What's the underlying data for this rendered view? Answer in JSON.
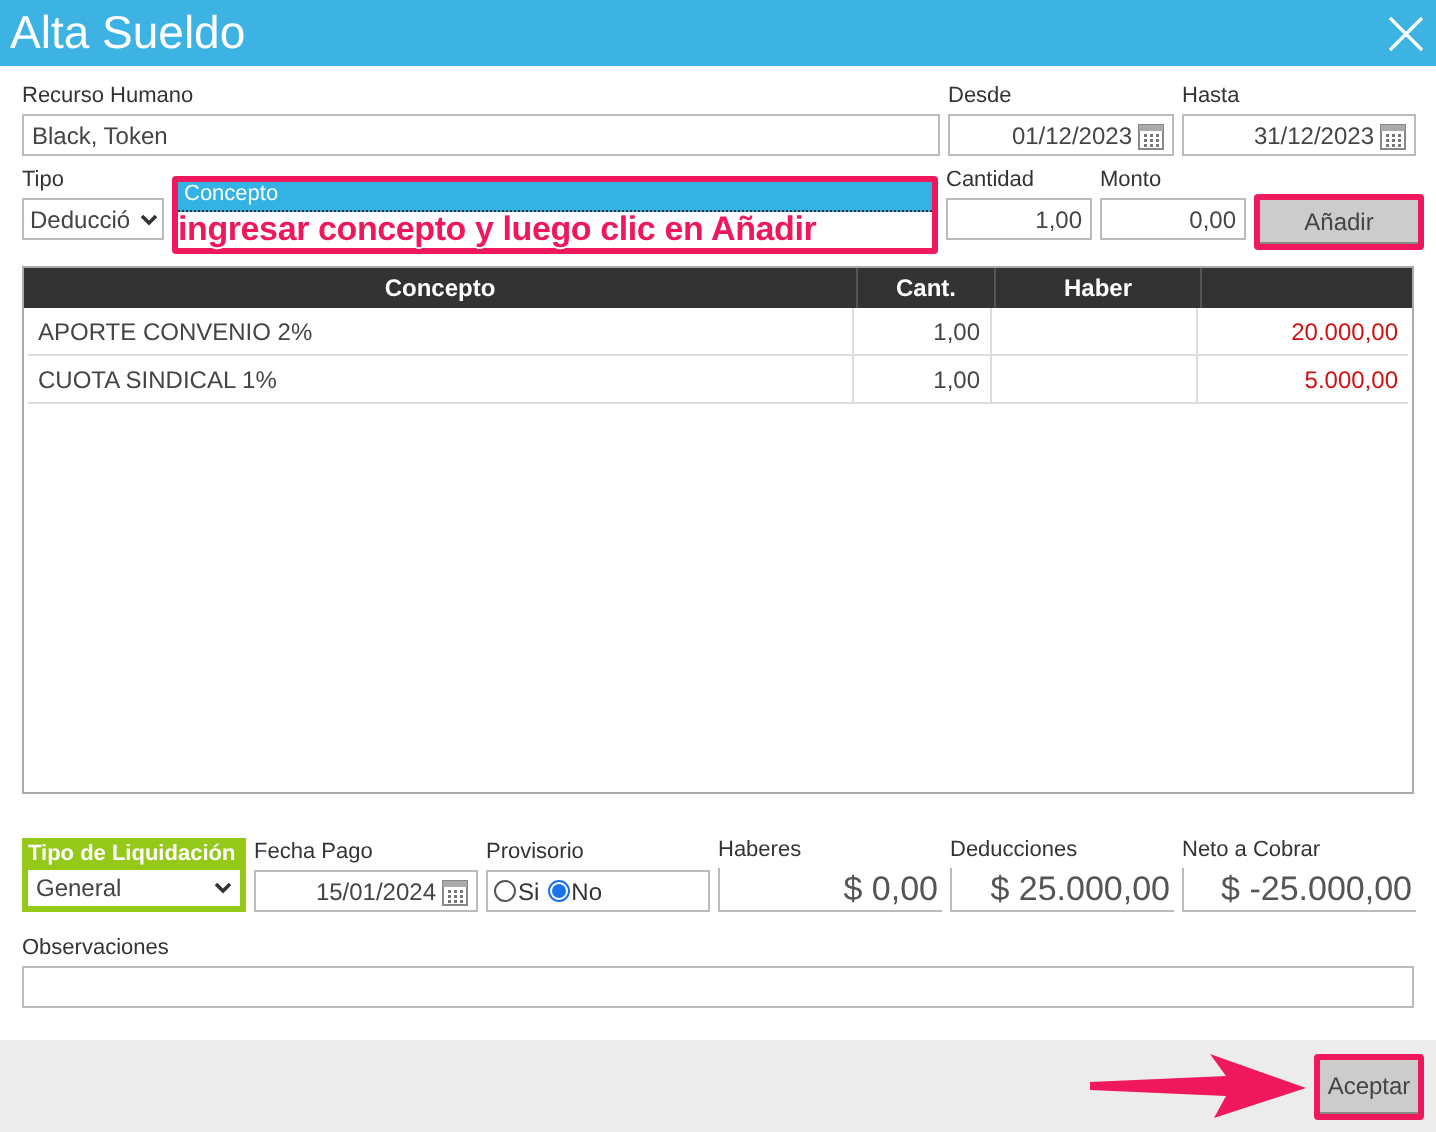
{
  "window": {
    "title": "Alta Sueldo"
  },
  "recurso_humano": {
    "label": "Recurso Humano",
    "value": "Black, Token"
  },
  "desde": {
    "label": "Desde",
    "value": "01/12/2023"
  },
  "hasta": {
    "label": "Hasta",
    "value": "31/12/2023"
  },
  "tipo": {
    "label": "Tipo",
    "value": "Deducció"
  },
  "concepto": {
    "label": "Concepto",
    "annotation": "ingresar concepto y luego clic en Añadir"
  },
  "cantidad": {
    "label": "Cantidad",
    "value": "1,00"
  },
  "monto": {
    "label": "Monto",
    "value": "0,00"
  },
  "add_button": "Añadir",
  "table": {
    "columns": [
      "Concepto",
      "Cant.",
      "Haber"
    ],
    "rows": [
      {
        "concepto": "APORTE CONVENIO 2%",
        "cant": "1,00",
        "column_4": "20.000,00"
      },
      {
        "concepto": "CUOTA SINDICAL 1%",
        "cant": "1,00",
        "column_4": "5.000,00"
      }
    ]
  },
  "tipo_liquidacion": {
    "label": "Tipo de Liquidación",
    "value": "General"
  },
  "fecha_pago": {
    "label": "Fecha Pago",
    "value": "15/01/2024"
  },
  "provisorio": {
    "label": "Provisorio",
    "options": [
      {
        "label": "Si",
        "selected": false
      },
      {
        "label": "No",
        "selected": true
      }
    ]
  },
  "haberes": {
    "label": "Haberes",
    "value": "$ 0,00"
  },
  "deducciones": {
    "label": "Deducciones",
    "value": "$ 25.000,00"
  },
  "neto": {
    "label": "Neto a Cobrar",
    "value": "$ -25.000,00"
  },
  "observaciones": {
    "label": "Observaciones"
  },
  "accept_button": "Aceptar"
}
